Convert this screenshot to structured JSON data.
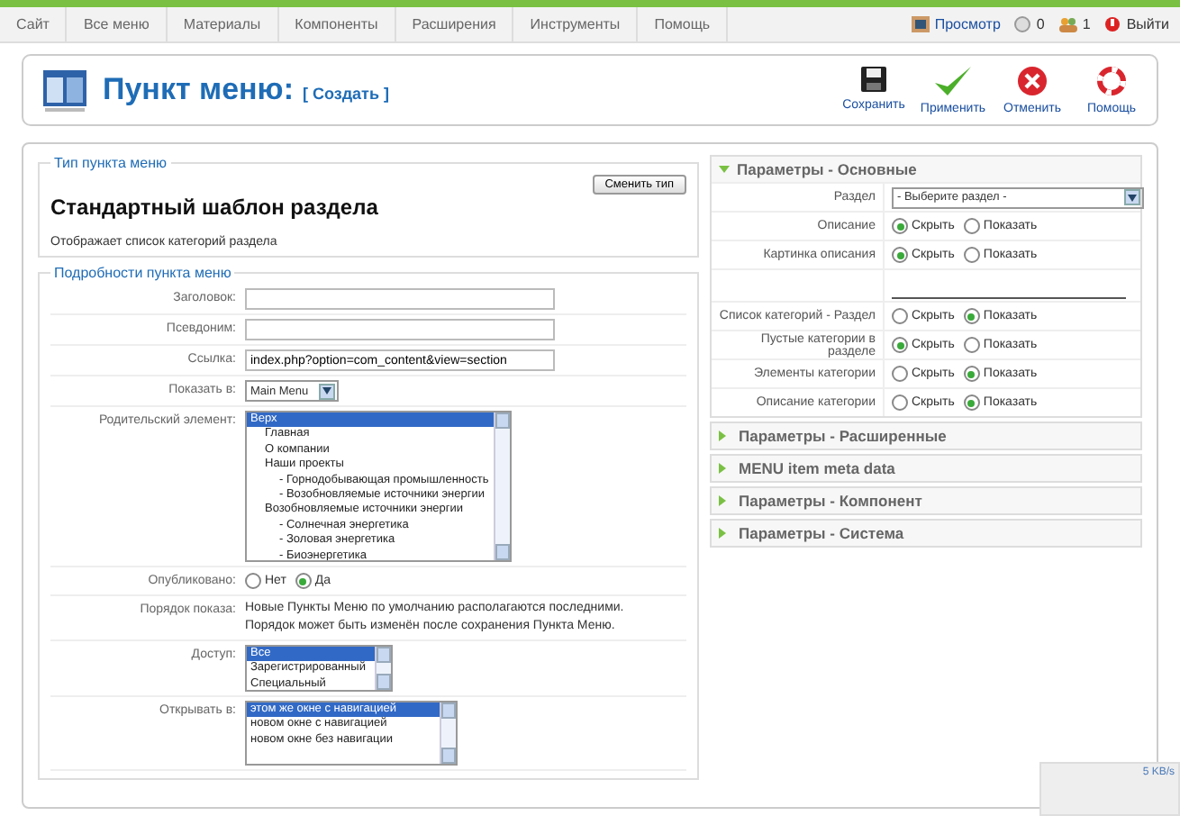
{
  "menu": [
    {
      "label": "Сайт"
    },
    {
      "label": "Все меню"
    },
    {
      "label": "Материалы"
    },
    {
      "label": "Компоненты"
    },
    {
      "label": "Расширения"
    },
    {
      "label": "Инструменты"
    },
    {
      "label": "Помощь"
    }
  ],
  "status": [
    {
      "kind": "preview",
      "label": "Просмотр"
    },
    {
      "kind": "messages",
      "label": "0"
    },
    {
      "kind": "users",
      "label": "1"
    },
    {
      "kind": "logout",
      "label": "Выйти"
    }
  ],
  "header": {
    "title": "Пункт меню:",
    "subtitle": "[ Создать ]"
  },
  "toolbar": [
    {
      "kind": "save",
      "label": "Сохранить"
    },
    {
      "kind": "apply",
      "label": "Применить"
    },
    {
      "kind": "cancel",
      "label": "Отменить"
    },
    {
      "kind": "help",
      "label": "Помощь"
    }
  ],
  "menu_type": {
    "legend": "Тип пункта меню",
    "button": "Сменить тип",
    "title": "Стандартный шаблон раздела",
    "description": "Отображает список категорий раздела"
  },
  "details": {
    "legend": "Подробности пункта меню",
    "fields": [
      {
        "kind": "text",
        "label": "Заголовок:"
      },
      {
        "kind": "text",
        "label": "Псевдоним:"
      },
      {
        "kind": "text",
        "label": "Ссылка:",
        "value": "index.php?option=com_content&view=section"
      },
      {
        "kind": "select",
        "label": "Показать в:",
        "value": "Main Menu"
      },
      {
        "kind": "tree",
        "label": "Родительский элемент:",
        "items": [
          {
            "label": "Верх",
            "selected": true,
            "children": [
              {
                "label": "Главная",
                "selected": false
              },
              {
                "label": "О компании",
                "selected": false
              },
              {
                "label": "Наши проекты",
                "selected": false,
                "children": [
                  {
                    "label": "- Горнодобывающая промышленность",
                    "selected": false
                  },
                  {
                    "label": "- Возобновляемые источники энергии",
                    "selected": false
                  }
                ]
              },
              {
                "label": "Возобновляемые источники энергии",
                "selected": false,
                "children": [
                  {
                    "label": "- Солнечная энергетика",
                    "selected": false
                  },
                  {
                    "label": "- Золовая энергетика",
                    "selected": false
                  },
                  {
                    "label": "- Биоэнергетика",
                    "selected": false
                  }
                ]
              }
            ]
          }
        ]
      },
      {
        "kind": "radio",
        "label": "Опубликовано:",
        "options": [
          {
            "label": "Нет",
            "selected": false
          },
          {
            "label": "Да",
            "selected": true
          }
        ]
      },
      {
        "kind": "note",
        "label": "Порядок показа:",
        "value": "Новые Пункты Меню по умолчанию располагаются последними. Порядок может быть изменён после сохранения Пункта Меню."
      },
      {
        "kind": "list",
        "label": "Доступ:",
        "items": [
          {
            "label": "Все",
            "selected": true
          },
          {
            "label": "Зарегистрированный",
            "selected": false
          },
          {
            "label": "Специальный",
            "selected": false
          }
        ]
      },
      {
        "kind": "list",
        "label": "Открывать в:",
        "items": [
          {
            "label": "этом же окне с навигацией",
            "selected": true
          },
          {
            "label": "новом окне с навигацией",
            "selected": false
          },
          {
            "label": "новом окне без навигации",
            "selected": false
          }
        ]
      }
    ]
  },
  "params": [
    {
      "title": "Параметры - Основные",
      "expanded": true,
      "rows": [
        {
          "kind": "select",
          "label": "Раздел",
          "value": "- Выберите раздел -"
        },
        {
          "kind": "radio",
          "label": "Описание",
          "options": [
            {
              "label": "Скрыть",
              "selected": true
            },
            {
              "label": "Показать",
              "selected": false
            }
          ]
        },
        {
          "kind": "radio",
          "label": "Картинка описания",
          "options": [
            {
              "label": "Скрыть",
              "selected": true
            },
            {
              "label": "Показать",
              "selected": false
            }
          ]
        },
        {
          "kind": "spacer"
        },
        {
          "kind": "radio",
          "label": "Список категорий - Раздел",
          "options": [
            {
              "label": "Скрыть",
              "selected": false
            },
            {
              "label": "Показать",
              "selected": true
            }
          ]
        },
        {
          "kind": "radio",
          "label": "Пустые категории в разделе",
          "options": [
            {
              "label": "Скрыть",
              "selected": true
            },
            {
              "label": "Показать",
              "selected": false
            }
          ]
        },
        {
          "kind": "radio",
          "label": "Элементы категории",
          "options": [
            {
              "label": "Скрыть",
              "selected": false
            },
            {
              "label": "Показать",
              "selected": true
            }
          ]
        },
        {
          "kind": "radio",
          "label": "Описание категории",
          "options": [
            {
              "label": "Скрыть",
              "selected": false
            },
            {
              "label": "Показать",
              "selected": true
            }
          ]
        }
      ]
    },
    {
      "title": "Параметры - Расширенные",
      "expanded": false
    },
    {
      "title": "MENU item meta data",
      "expanded": false
    },
    {
      "title": "Параметры - Компонент",
      "expanded": false
    },
    {
      "title": "Параметры - Система",
      "expanded": false
    }
  ],
  "speed": "5 KB/s"
}
